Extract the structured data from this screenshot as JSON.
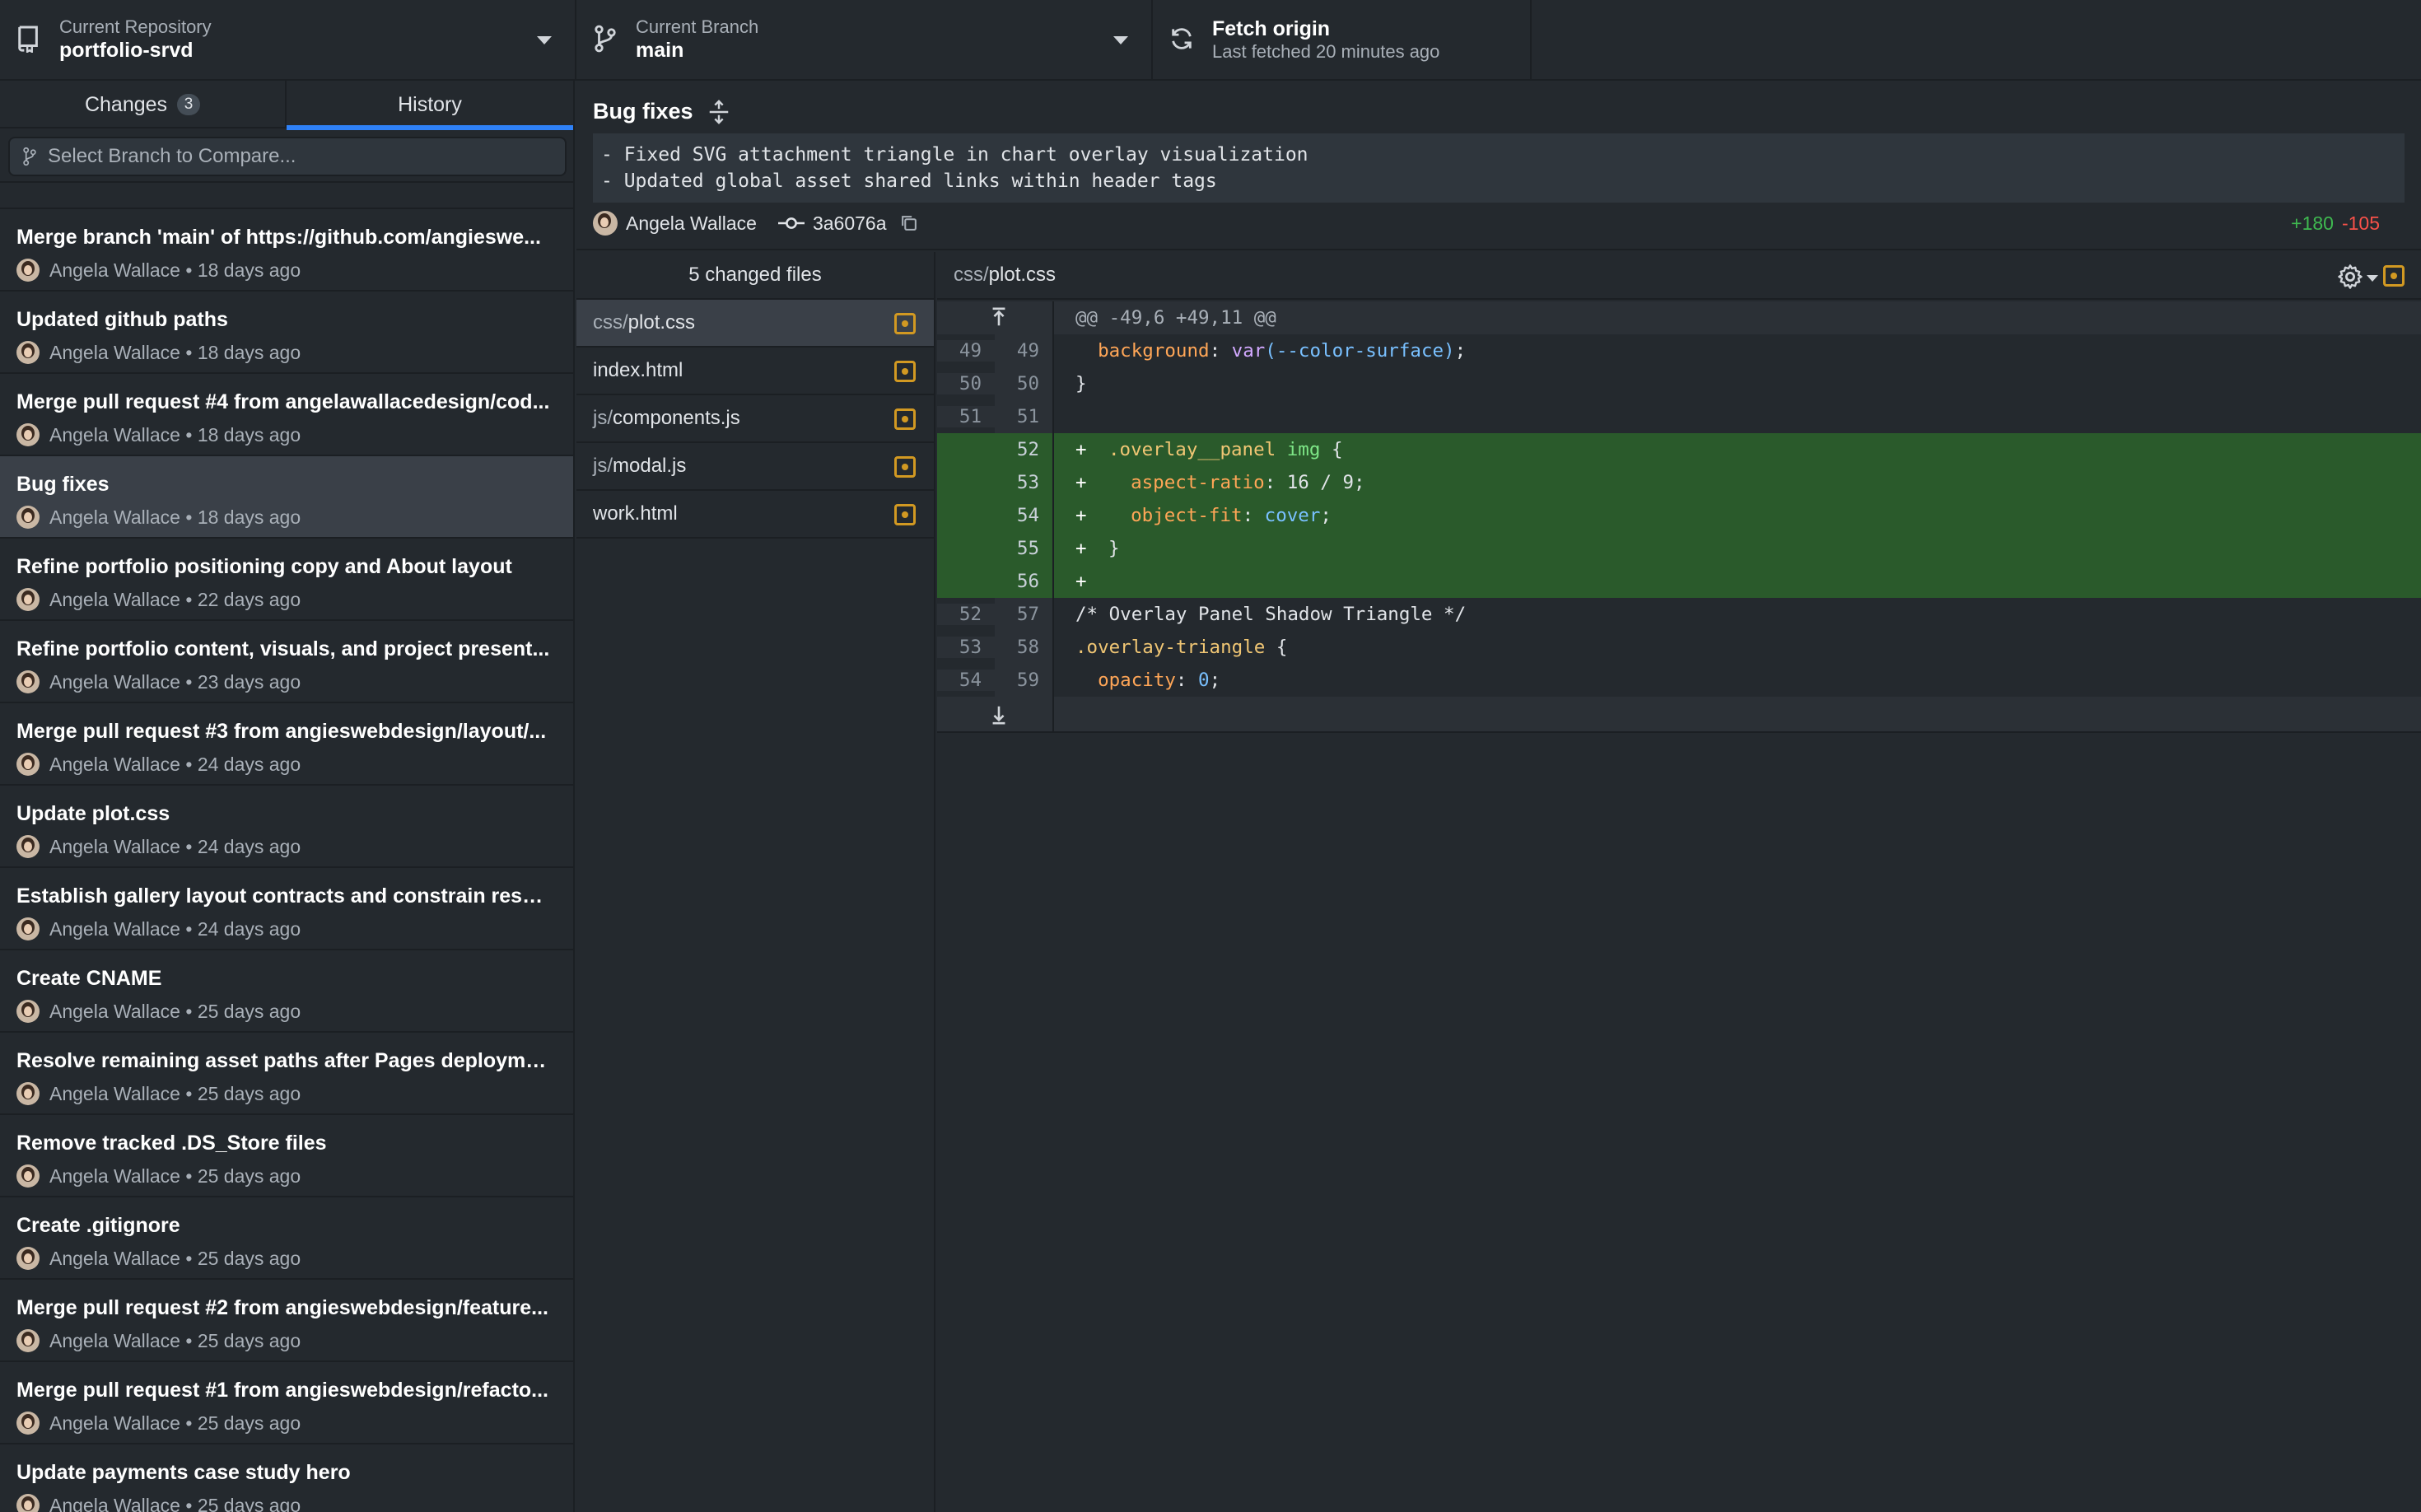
{
  "toolbar": {
    "repo_label": "Current Repository",
    "repo_name": "portfolio-srvd",
    "branch_label": "Current Branch",
    "branch_name": "main",
    "fetch_title": "Fetch origin",
    "fetch_subtitle": "Last fetched 20 minutes ago"
  },
  "sidebar": {
    "tab_changes": "Changes",
    "changes_count": "3",
    "tab_history": "History",
    "compare_placeholder": "Select Branch to Compare...",
    "commits": [
      {
        "summary": "Merge branch 'main' of https://github.com/angieswe...",
        "author": "Angela Wallace",
        "age": "18 days ago"
      },
      {
        "summary": "Updated github paths",
        "author": "Angela Wallace",
        "age": "18 days ago"
      },
      {
        "summary": "Merge pull request #4 from angelawallacedesign/cod...",
        "author": "Angela Wallace",
        "age": "18 days ago"
      },
      {
        "summary": "Bug fixes",
        "author": "Angela Wallace",
        "age": "18 days ago"
      },
      {
        "summary": "Refine portfolio positioning copy and About layout",
        "author": "Angela Wallace",
        "age": "22 days ago"
      },
      {
        "summary": "Refine portfolio content, visuals, and project present...",
        "author": "Angela Wallace",
        "age": "23 days ago"
      },
      {
        "summary": "Merge pull request #3 from angieswebdesign/layout/...",
        "author": "Angela Wallace",
        "age": "24 days ago"
      },
      {
        "summary": "Update plot.css",
        "author": "Angela Wallace",
        "age": "24 days ago"
      },
      {
        "summary": "Establish gallery layout contracts and constrain resp...",
        "author": "Angela Wallace",
        "age": "24 days ago"
      },
      {
        "summary": "Create CNAME",
        "author": "Angela Wallace",
        "age": "25 days ago"
      },
      {
        "summary": "Resolve remaining asset paths after Pages deployment",
        "author": "Angela Wallace",
        "age": "25 days ago"
      },
      {
        "summary": "Remove tracked .DS_Store files",
        "author": "Angela Wallace",
        "age": "25 days ago"
      },
      {
        "summary": "Create .gitignore",
        "author": "Angela Wallace",
        "age": "25 days ago"
      },
      {
        "summary": "Merge pull request #2 from angieswebdesign/feature...",
        "author": "Angela Wallace",
        "age": "25 days ago"
      },
      {
        "summary": "Merge pull request #1 from angieswebdesign/refacto...",
        "author": "Angela Wallace",
        "age": "25 days ago"
      },
      {
        "summary": "Update payments case study hero",
        "author": "Angela Wallace",
        "age": "25 days ago"
      }
    ]
  },
  "commit": {
    "title": "Bug fixes",
    "body": "- Fixed SVG attachment triangle in chart overlay visualization\n- Updated global asset shared links within header tags",
    "author": "Angela Wallace",
    "sha": "3a6076a",
    "added": "+180",
    "removed": "-105"
  },
  "files": {
    "header": "5 changed files",
    "items": [
      {
        "dir": "css/",
        "name": "plot.css"
      },
      {
        "dir": "",
        "name": "index.html"
      },
      {
        "dir": "js/",
        "name": "components.js"
      },
      {
        "dir": "js/",
        "name": "modal.js"
      },
      {
        "dir": "",
        "name": "work.html"
      }
    ]
  },
  "diff": {
    "file_dir": "css/",
    "file_name": "plot.css",
    "hunk_header": "@@ -49,6 +49,11 @@",
    "lines": [
      {
        "old": "49",
        "new": "49",
        "mark": "",
        "indent": "  ",
        "prop": "background",
        "sep": ": ",
        "fn": "var",
        "val": "(--color-surface)",
        "end": ";"
      },
      {
        "old": "50",
        "new": "50",
        "text": "}"
      },
      {
        "old": "51",
        "new": "51",
        "text": ""
      },
      {
        "new": "52",
        "mark": "+",
        "sel": ".overlay__panel",
        "tag": "img",
        "end": "{"
      },
      {
        "new": "53",
        "mark": "+",
        "indent": "  ",
        "prop": "aspect-ratio",
        "sep": ": ",
        "val": "16 / 9",
        "end": ";"
      },
      {
        "new": "54",
        "mark": "+",
        "indent": "  ",
        "prop": "object-fit",
        "sep": ": ",
        "val": "cover",
        "end": ";"
      },
      {
        "new": "55",
        "mark": "+",
        "text": "}"
      },
      {
        "new": "56",
        "mark": "+",
        "text": ""
      },
      {
        "old": "52",
        "new": "57",
        "comment": "/* Overlay Panel Shadow Triangle */"
      },
      {
        "old": "53",
        "new": "58",
        "sel": ".overlay-triangle",
        "end": "{"
      },
      {
        "old": "54",
        "new": "59",
        "indent": "  ",
        "prop": "opacity",
        "sep": ": ",
        "val": "0",
        "end": ";"
      }
    ]
  },
  "colors": {
    "accent": "#2f81f7",
    "added": "#3fb950",
    "removed": "#f85149",
    "modified": "#d29922"
  }
}
